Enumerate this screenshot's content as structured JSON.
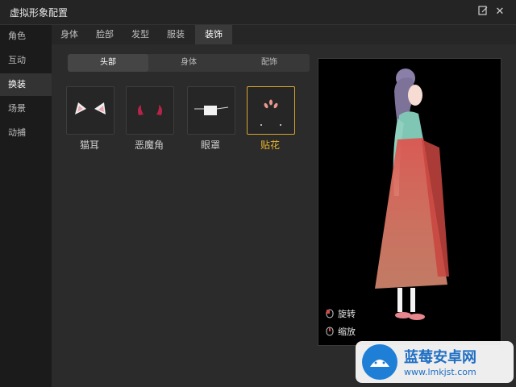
{
  "window": {
    "title": "虚拟形象配置"
  },
  "sidebar": {
    "items": [
      {
        "label": "角色"
      },
      {
        "label": "互动"
      },
      {
        "label": "换装"
      },
      {
        "label": "场景"
      },
      {
        "label": "动捕"
      }
    ],
    "active_index": 2
  },
  "tabs": {
    "items": [
      {
        "label": "身体"
      },
      {
        "label": "脸部"
      },
      {
        "label": "发型"
      },
      {
        "label": "服装"
      },
      {
        "label": "装饰"
      }
    ],
    "active_index": 4
  },
  "subtabs": {
    "items": [
      {
        "label": "头部"
      },
      {
        "label": "身体"
      },
      {
        "label": "配饰"
      }
    ],
    "active_index": 0
  },
  "accessories": [
    {
      "label": "猫耳",
      "icon": "cat-ears-icon"
    },
    {
      "label": "恶魔角",
      "icon": "devil-horns-icon"
    },
    {
      "label": "眼罩",
      "icon": "eye-mask-icon"
    },
    {
      "label": "贴花",
      "icon": "decal-icon",
      "selected": true
    }
  ],
  "preview": {
    "controls": [
      {
        "label": "旋转",
        "icon": "mouse-rotate-icon"
      },
      {
        "label": "缩放",
        "icon": "mouse-scroll-icon"
      }
    ]
  },
  "watermark": {
    "brand": "蓝莓安卓网",
    "url": "www.lmkjst.com"
  },
  "colors": {
    "accent": "#e8b52a",
    "background": "#2b2b2b"
  }
}
